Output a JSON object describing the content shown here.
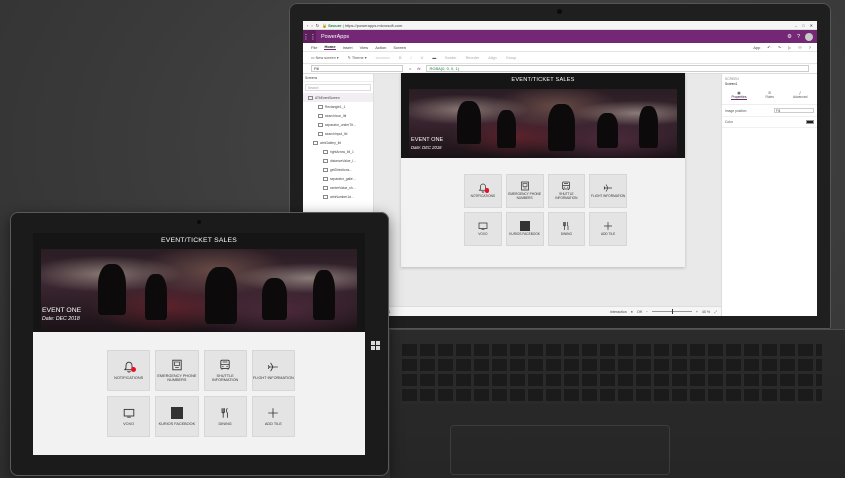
{
  "browser": {
    "secure_label": "Secure",
    "url": "https://powerapps.microsoft.com"
  },
  "studio": {
    "product": "PowerApps",
    "ribbon_tabs": [
      "File",
      "Home",
      "Insert",
      "View",
      "Action",
      "Screen"
    ],
    "active_tab": "Home",
    "app_label": "App",
    "toolbar": {
      "new_screen": "New screen",
      "theme": "Theme",
      "border": "Border",
      "reorder": "Reorder",
      "align": "Align",
      "group": "Group"
    },
    "formula": {
      "property": "Fill",
      "fx": "fx",
      "expression": "RGBA(0, 0, 0, 1)"
    },
    "tree": {
      "header": "Screens",
      "search_placeholder": "Search",
      "nodes": [
        "ATbEventScreen",
        "Rectangle1_1",
        "searchIcon_lbl",
        "separator_underTit…",
        "searchInput_lbl",
        "atmGallery_lbl",
        "rightArrow_lbl_1",
        "distanceValue_l…",
        "getDirections…",
        "separator_galle…",
        "centerValue_sh…",
        "atmNumber1d…"
      ]
    },
    "props_panel": {
      "caption": "SCREEN",
      "name": "Screen1",
      "tabs": [
        "Properties",
        "Rules",
        "Advanced"
      ],
      "image_position_label": "Image position",
      "image_position_value": "Fill",
      "color_label": "Color"
    },
    "status": {
      "screen": "Screen1",
      "interaction_label": "Interaction",
      "interaction_value": "Off",
      "zoom": "40 %"
    }
  },
  "app": {
    "header_title": "EVENT/TICKET SALES",
    "event_name": "EVENT ONE",
    "event_date": "Date: DEC 2018",
    "tiles": [
      {
        "label": "NOTIFICATIONS",
        "icon": "bell-icon"
      },
      {
        "label": "EMERGENCY PHONE NUMBERS",
        "icon": "phone-book-icon"
      },
      {
        "label": "SHUTTLE INFORMATION",
        "icon": "bus-icon"
      },
      {
        "label": "FLIGHT INFORMATION",
        "icon": "airplane-icon"
      },
      {
        "label": "VOXO",
        "icon": "monitor-icon"
      },
      {
        "label": "KURIOS FACEBOOK",
        "icon": "facebook-icon"
      },
      {
        "label": "DINING",
        "icon": "fork-knife-icon"
      },
      {
        "label": "ADD TILE",
        "icon": "plus-icon"
      }
    ],
    "notification_badge_color": "#e81123"
  },
  "colors": {
    "powerapps_purple": "#742774",
    "banner_bg": "#151515",
    "tile_bg": "#e4e4e4"
  }
}
